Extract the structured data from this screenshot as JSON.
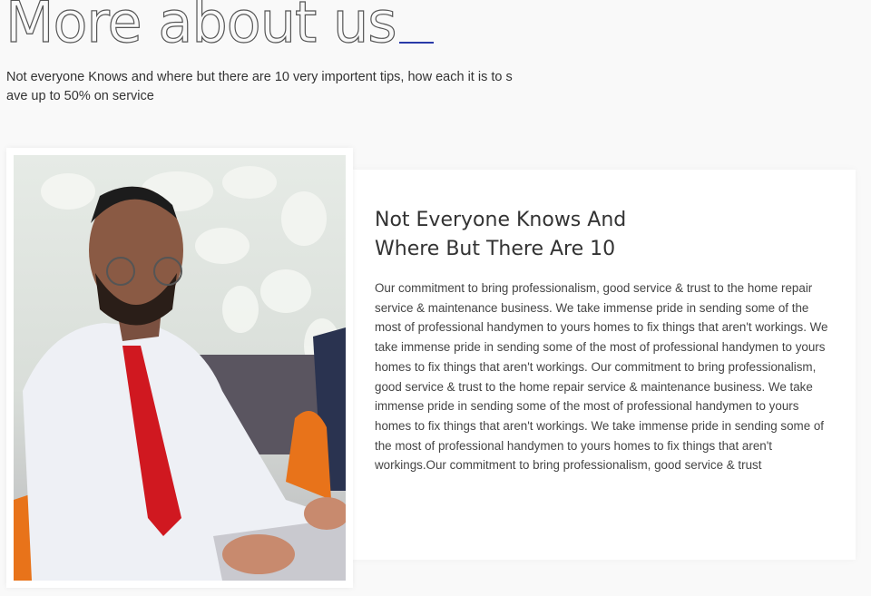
{
  "header": {
    "title": "More about us",
    "accent_color": "#2a3aa8",
    "intro": "Not everyone Knows and where but there are 10 very importent tips, how each it is to save up to 50% on service"
  },
  "image": {
    "description_icon": "photo-man-with-laptop"
  },
  "card": {
    "heading": "Not Everyone Knows And Where But There Are 10",
    "body": "Our commitment to bring professionalism, good service & trust to the home repair service & maintenance business. We take immense pride in sending some of the most of professional handymen to yours homes to fix things that aren't workings. We take immense pride in sending some of the most of professional handymen to yours homes to fix things that aren't workings. Our commitment to bring professionalism, good service & trust to the home repair service & maintenance business. We take immense pride in sending some of the most of professional handymen to yours homes to fix things that aren't workings. We take immense pride in sending some of the most of professional handymen to yours homes to fix things that aren't workings.Our commitment to bring professionalism, good service & trust"
  }
}
